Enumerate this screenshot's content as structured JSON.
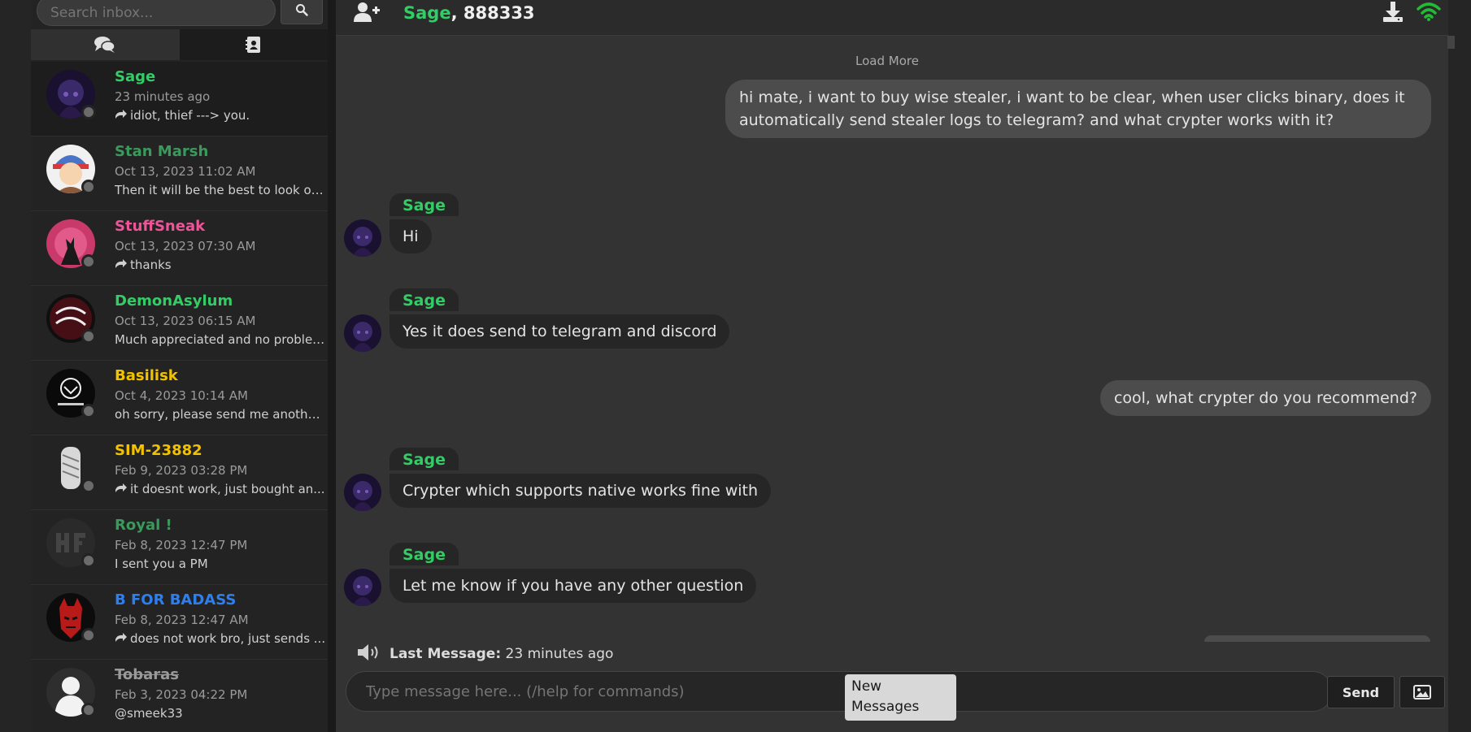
{
  "sidebar": {
    "search": {
      "placeholder": "Search inbox..."
    },
    "tabs": [
      {
        "icon": "chat-bubbles-icon",
        "active": false
      },
      {
        "icon": "contact-card-icon",
        "active": true
      }
    ],
    "conversations": [
      {
        "name": "Sage",
        "name_color": "#33cc66",
        "strike": false,
        "time": "23 minutes ago",
        "reply_icon": true,
        "message": "idiot, thief ---> you.",
        "active": true
      },
      {
        "name": "Stan Marsh",
        "name_color": "#3a9a5c",
        "strike": false,
        "time": "Oct 13, 2023 11:02 AM",
        "reply_icon": false,
        "message": "Then it will be the best to look on...",
        "active": false
      },
      {
        "name": "StuffSneak",
        "name_color": "#ee5599",
        "strike": false,
        "time": "Oct 13, 2023 07:30 AM",
        "reply_icon": true,
        "message": "thanks",
        "active": false
      },
      {
        "name": "DemonAsylum",
        "name_color": "#33cc66",
        "strike": false,
        "time": "Oct 13, 2023 06:15 AM",
        "reply_icon": false,
        "message": "Much appreciated and no problem!",
        "active": false
      },
      {
        "name": "Basilisk",
        "name_color": "#f2c200",
        "strike": false,
        "time": "Oct 4, 2023 10:14 AM",
        "reply_icon": false,
        "message": "oh sorry, please send me anothe...",
        "active": false
      },
      {
        "name": "SIM-23882",
        "name_color": "#f2c200",
        "strike": false,
        "time": "Feb 9, 2023 03:28 PM",
        "reply_icon": true,
        "message": "it doesnt work, just bought an...",
        "active": false
      },
      {
        "name": "Royal !",
        "name_color": "#3a9a5c",
        "strike": false,
        "time": "Feb 8, 2023 12:47 PM",
        "reply_icon": false,
        "message": "I sent you a PM",
        "active": false
      },
      {
        "name": "B FOR BADASS",
        "name_color": "#2d7ff0",
        "strike": false,
        "time": "Feb 8, 2023 12:47 AM",
        "reply_icon": true,
        "message": "does not work bro, just sends ...",
        "active": false
      },
      {
        "name": "Tobaras",
        "name_color": "#9a9a9a",
        "strike": true,
        "time": "Feb 3, 2023 04:22 PM",
        "reply_icon": false,
        "message": "@smeek33",
        "active": false
      }
    ]
  },
  "chat": {
    "header": {
      "name": "Sage",
      "suffix": ", 888333"
    },
    "load_more": "Load More",
    "messages": [
      {
        "direction": "out",
        "text": "hi mate, i want to buy wise stealer, i want to be clear, when user clicks binary, does it automatically send stealer logs to telegram? and what crypter works with it?"
      },
      {
        "direction": "in",
        "sender": "Sage",
        "text": "Hi"
      },
      {
        "direction": "in",
        "sender": "Sage",
        "text": "Yes it does send to telegram and discord"
      },
      {
        "direction": "out",
        "text": "cool, what crypter do you recommend?"
      },
      {
        "direction": "in",
        "sender": "Sage",
        "text": "Crypter which supports native works fine with"
      },
      {
        "direction": "in",
        "sender": "Sage",
        "text": "Let me know if you have any other question"
      }
    ],
    "last_message_label": "Last Message:",
    "last_message_value": "23 minutes ago",
    "composer_placeholder": "Type message here... (/help for commands)",
    "new_messages_line1": "New",
    "new_messages_line2": "Messages",
    "send_label": "Send"
  },
  "colors": {
    "accent_green": "#33cc66",
    "online_wifi": "#22bb33"
  }
}
